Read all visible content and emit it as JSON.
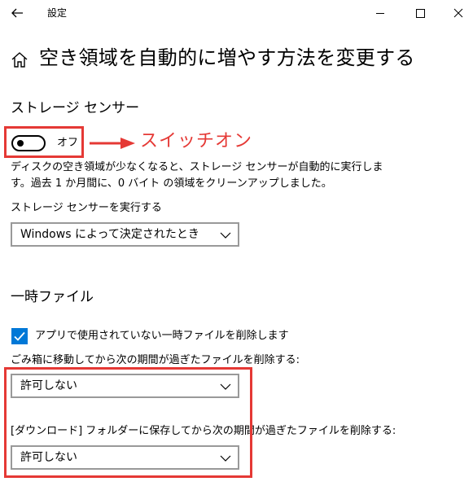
{
  "window": {
    "title": "設定"
  },
  "page": {
    "title": "空き領域を自動的に増やす方法を変更する"
  },
  "storage_sense": {
    "section_title": "ストレージ センサー",
    "toggle_state_label": "オフ",
    "toggle_on": false,
    "annotation": "スイッチオン",
    "annotation_color": "#e53935",
    "description_line1": "ディスクの空き領域が少なくなると、ストレージ センサーが自動的に実行しま",
    "description_line2": "す。過去 1 か月間に、0 バイト の領域をクリーンアップしました。",
    "run_label": "ストレージ センサーを実行する",
    "run_selected": "Windows によって決定されたとき"
  },
  "temp_files": {
    "section_title": "一時ファイル",
    "checkbox_label": "アプリで使用されていない一時ファイルを削除します",
    "checkbox_checked": true,
    "trash_label": "ごみ箱に移動してから次の期間が過ぎたファイルを削除する:",
    "trash_selected": "許可しない",
    "downloads_label": "[ダウンロード] フォルダーに保存してから次の期間が過ぎたファイルを削除する:",
    "downloads_selected": "許可しない"
  },
  "colors": {
    "accent": "#0078d7",
    "highlight": "#e53935"
  },
  "icons": {
    "back": "back-arrow-icon",
    "minimize": "minimize-icon",
    "maximize": "maximize-icon",
    "close": "close-icon",
    "home": "home-icon",
    "chevron": "chevron-down-icon",
    "check": "check-icon"
  }
}
